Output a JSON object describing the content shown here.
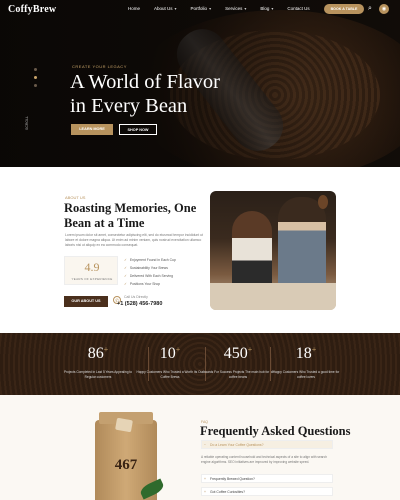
{
  "brand": {
    "name": "CoffyBrew",
    "accent": "#b8935e",
    "dark": "#2e1d11"
  },
  "nav": {
    "items": [
      {
        "label": "Home",
        "has_caret": false
      },
      {
        "label": "About Us",
        "has_caret": true
      },
      {
        "label": "Portfolio",
        "has_caret": true
      },
      {
        "label": "Services",
        "has_caret": true
      },
      {
        "label": "Blog",
        "has_caret": true
      },
      {
        "label": "Contact Us",
        "has_caret": false
      }
    ],
    "cta_label": "BOOK A TABLE",
    "search_icon": "search-icon",
    "cart_icon": "cart-icon"
  },
  "hero": {
    "eyebrow": "CREATE YOUR LEGACY",
    "title_line1": "A World of Flavor",
    "title_line2": "in Every Bean",
    "primary_button": "LEARN MORE",
    "secondary_button": "SHOP NOW",
    "side_label": "SCROLL"
  },
  "about": {
    "eyebrow": "ABOUT US",
    "title_line1": "Roasting Memories, One",
    "title_line2": "Bean at a Time",
    "paragraph": "Lorem ipsum dolor sit amet, consectetur adipiscing elit, sed do eiusmod tempor incididunt ut labore et dolore magna aliqua. Ut enim ad minim veniam, quis nostrud exercitation ullamco laboris nisi ut aliquip ex ea commodo consequat.",
    "years_number": "4.9",
    "years_label": "YEARS OF EXPERIENCE",
    "checklist": [
      "Enjoyment Found in Each Cup",
      "Sustainability Your Brews",
      "Delivered With Each Serving",
      "Positions Your Shop"
    ],
    "button_label": "OUR ABOUT US",
    "call_label": "Call Us Directly",
    "call_number": "+1 (528) 456-7980"
  },
  "stats": [
    {
      "number": "86",
      "label": "Projects Completed in Last 5 Years Appealing to Regular customers"
    },
    {
      "number": "10",
      "label": "Happy Customers Who Trusted a Worth Its Our Coffee Brews"
    },
    {
      "number": "450",
      "label": "Awards For Success Projects The main hub for all coffee beans"
    },
    {
      "number": "18",
      "label": "Happy Customers Who Trusted a good time for coffee lovers"
    }
  ],
  "faq": {
    "eyebrow": "FAQ",
    "title": "Frequently Asked Questions",
    "open_question": "Do a Learn Your Coffee Questions?",
    "answer": "A reliable operating content household and technical aspects of a site to align with search engine algorithms. SEO initiatives are improved by improving website speed.",
    "questions": [
      "Frequently Brewed Question?",
      "Got Coffee Curiosities?"
    ],
    "bag_number": "467"
  }
}
